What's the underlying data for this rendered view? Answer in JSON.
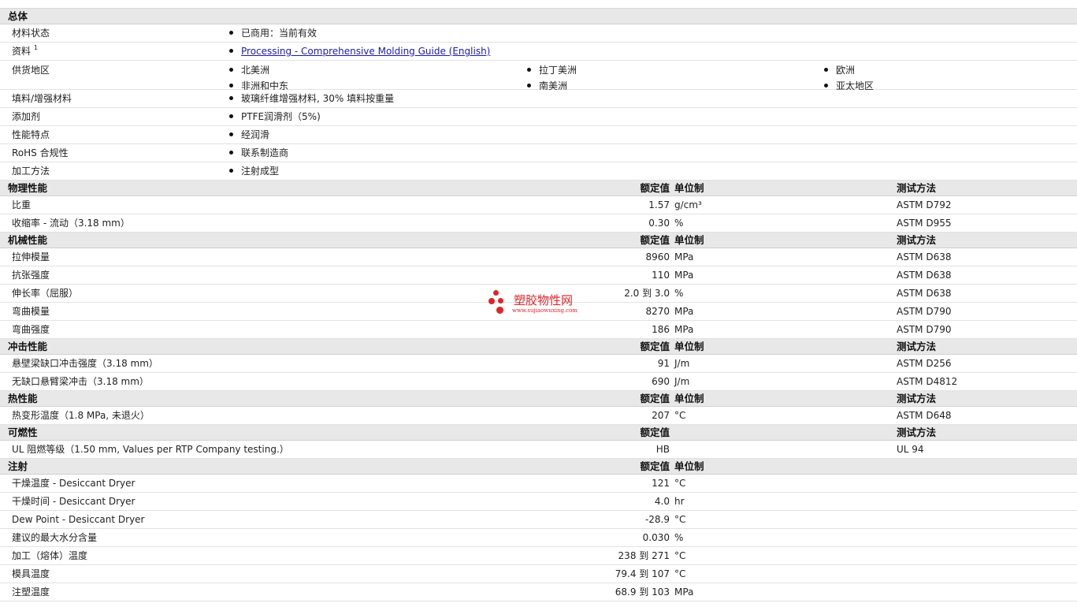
{
  "general": {
    "title": "总体",
    "material_status": {
      "label": "材料状态",
      "value": "已商用：当前有效"
    },
    "literature": {
      "label": "资料",
      "sup": "1",
      "link": "Processing - Comprehensive Molding Guide (English)"
    },
    "availability": {
      "label": "供货地区",
      "regions": [
        "北美洲",
        "拉丁美洲",
        "欧洲",
        "非洲和中东",
        "南美洲",
        "亚太地区"
      ]
    },
    "filler": {
      "label": "填料/增强材料",
      "value": "玻璃纤维增强材料, 30% 填料按重量"
    },
    "additive": {
      "label": "添加剂",
      "value": "PTFE润滑剂（5%)"
    },
    "features": {
      "label": "性能特点",
      "value": "经润滑"
    },
    "rohs": {
      "label": "RoHS 合规性",
      "value": "联系制造商"
    },
    "processing": {
      "label": "加工方法",
      "value": "注射成型"
    }
  },
  "headers": {
    "nominal": "额定值",
    "unit": "单位制",
    "test": "测试方法"
  },
  "physical": {
    "title": "物理性能",
    "rows": [
      {
        "label": "比重",
        "value": "1.57",
        "unit": "g/cm³",
        "test": "ASTM D792"
      },
      {
        "label": "收缩率  - 流动（3.18 mm）",
        "value": "0.30",
        "unit": "%",
        "test": "ASTM D955"
      }
    ]
  },
  "mechanical": {
    "title": "机械性能",
    "rows": [
      {
        "label": "拉伸模量",
        "value": "8960",
        "unit": "MPa",
        "test": "ASTM D638"
      },
      {
        "label": "抗张强度",
        "value": "110",
        "unit": "MPa",
        "test": "ASTM D638"
      },
      {
        "label": "伸长率（屈服）",
        "value": "2.0 到  3.0",
        "unit": "%",
        "test": "ASTM D638"
      },
      {
        "label": "弯曲模量",
        "value": "8270",
        "unit": "MPa",
        "test": "ASTM D790"
      },
      {
        "label": "弯曲强度",
        "value": "186",
        "unit": "MPa",
        "test": "ASTM D790"
      }
    ]
  },
  "impact": {
    "title": "冲击性能",
    "rows": [
      {
        "label": "悬壁梁缺口冲击强度（3.18 mm）",
        "value": "91",
        "unit": "J/m",
        "test": "ASTM D256"
      },
      {
        "label": "无缺口悬臂梁冲击（3.18 mm）",
        "value": "690",
        "unit": "J/m",
        "test": "ASTM D4812"
      }
    ]
  },
  "thermal": {
    "title": "热性能",
    "rows": [
      {
        "label": "热变形温度（1.8 MPa, 未退火）",
        "value": "207",
        "unit": "°C",
        "test": "ASTM D648"
      }
    ]
  },
  "flammability": {
    "title": "可燃性",
    "rows": [
      {
        "label": "UL 阻燃等级（1.50 mm, Values per RTP Company testing.）",
        "value": "HB",
        "unit": "",
        "test": "UL 94"
      }
    ]
  },
  "injection": {
    "title": "注射",
    "rows": [
      {
        "label": "干燥温度  - Desiccant Dryer",
        "value": "121",
        "unit": "°C"
      },
      {
        "label": "干燥时间  - Desiccant Dryer",
        "value": "4.0",
        "unit": "hr"
      },
      {
        "label": "Dew Point - Desiccant Dryer",
        "value": "-28.9",
        "unit": "°C"
      },
      {
        "label": "建议的最大水分含量",
        "value": "0.030",
        "unit": "%"
      },
      {
        "label": "加工（熔体）温度",
        "value": "238 到  271",
        "unit": "°C"
      },
      {
        "label": "模具温度",
        "value": "79.4 到  107",
        "unit": "°C"
      },
      {
        "label": "注塑温度",
        "value": "68.9 到  103",
        "unit": "MPa"
      }
    ]
  },
  "watermark": {
    "name": "塑胶物性网",
    "url": "www.sujiaowuxing.com",
    "color": "#e0242a"
  }
}
